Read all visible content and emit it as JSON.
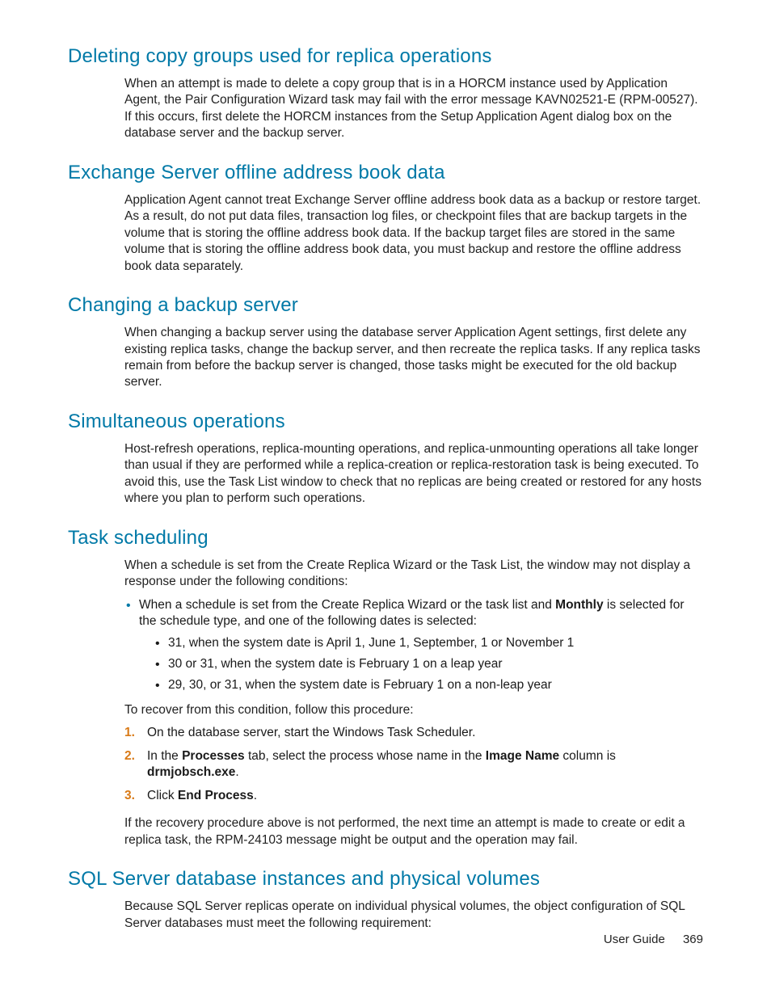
{
  "sections": {
    "s1": {
      "title": "Deleting copy groups used for replica operations",
      "body": "When an attempt is made to delete a copy group that is in a HORCM instance used by Application Agent, the Pair Configuration Wizard task may fail with the error message KAVN02521-E (RPM-00527). If this occurs, first delete the HORCM instances from the Setup Application Agent dialog box on the database server and the backup server."
    },
    "s2": {
      "title": "Exchange Server offline address book data",
      "body": "Application Agent cannot treat Exchange Server offline address book data as a backup or restore target. As a result, do not put data files, transaction log files, or checkpoint files that are backup targets in the volume that is storing the offline address book data. If the backup target files are stored in the same volume that is storing the offline address book data, you must backup and restore the offline address book data separately."
    },
    "s3": {
      "title": "Changing a backup server",
      "body": "When changing a backup server using the database server Application Agent settings, first delete any existing replica tasks, change the backup server, and then recreate the replica tasks. If any replica tasks remain from before the backup server is changed, those tasks might be executed for the old backup server."
    },
    "s4": {
      "title": "Simultaneous operations",
      "body": "Host-refresh operations, replica-mounting operations, and replica-unmounting operations all take longer than usual if they are performed while a replica-creation or replica-restoration task is being executed. To avoid this, use the Task List window to check that no replicas are being created or restored for any hosts where you plan to perform such operations."
    },
    "s5": {
      "title": "Task scheduling",
      "intro": "When a schedule is set from the Create Replica Wizard or the Task List, the window may not display a response under the following conditions:",
      "bullet1_pre": "When a schedule is set from the Create Replica Wizard or the task list and ",
      "bullet1_bold": "Monthly",
      "bullet1_post": " is selected for the schedule type, and one of the following dates is selected:",
      "sub": {
        "a": "31, when the system date is April 1, June 1, September, 1 or November 1",
        "b": "30 or 31, when the system date is February 1 on a leap year",
        "c": "29, 30, or 31, when the system date is February 1 on a non-leap year"
      },
      "recover": "To recover from this condition, follow this procedure:",
      "steps": {
        "n1": "On the database server, start the Windows Task Scheduler.",
        "n2_a": "In the ",
        "n2_b": "Processes",
        "n2_c": " tab, select the process whose name in the ",
        "n2_d": "Image Name",
        "n2_e": " column is ",
        "n2_f": "drmjobsch.exe",
        "n2_g": ".",
        "n3_a": "Click ",
        "n3_b": "End Process",
        "n3_c": "."
      },
      "after": "If the recovery procedure above is not performed, the next time an attempt is made to create or edit a replica task, the RPM-24103 message might be output and the operation may fail."
    },
    "s6": {
      "title": "SQL Server database instances and physical volumes",
      "body": "Because SQL Server replicas operate on individual physical volumes, the object configuration of SQL Server databases must meet the following requirement:"
    }
  },
  "footer": {
    "label": "User Guide",
    "page": "369"
  }
}
